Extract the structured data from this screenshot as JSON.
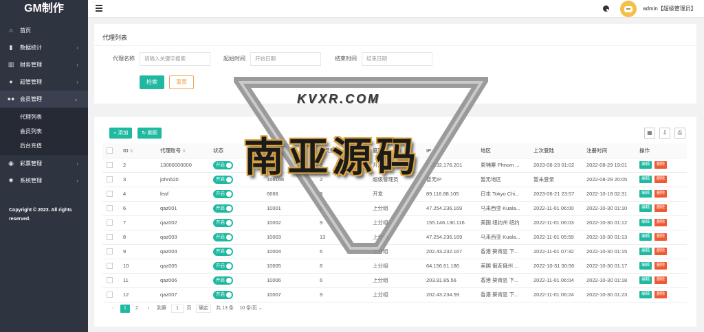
{
  "brand": "GM制作",
  "sidebar": {
    "items": [
      {
        "label": "首页"
      },
      {
        "label": "数据统计"
      },
      {
        "label": "财务管理"
      },
      {
        "label": "超管管理"
      },
      {
        "label": "会员管理"
      },
      {
        "label": "彩票管理"
      },
      {
        "label": "系统管理"
      }
    ],
    "submenu": [
      {
        "label": "代理列表"
      },
      {
        "label": "会员列表"
      },
      {
        "label": "后台充值"
      }
    ],
    "copyright_line1": "Copyright © 2023. All rights",
    "copyright_line2": "reserved."
  },
  "header": {
    "user": "admin【超级管理员】"
  },
  "search_panel": {
    "title": "代理列表",
    "fields": [
      {
        "label": "代理名称",
        "placeholder": "请输入关键字搜索"
      },
      {
        "label": "起始时间",
        "placeholder": "开始日期"
      },
      {
        "label": "结束时间",
        "placeholder": "结束日期"
      }
    ],
    "search_label": "检索",
    "reset_label": "重置"
  },
  "list_panel": {
    "add_label": "添加",
    "refresh_label": "刷新",
    "columns": [
      "ID",
      "代理账号",
      "状态",
      "邀请码",
      "成员数",
      "管理组",
      "IP",
      "地区",
      "上次登陆",
      "注册时间",
      "操作"
    ],
    "status_label": "开启",
    "edit_label": "编辑",
    "delete_label": "删除",
    "rows": [
      {
        "id": "2",
        "account": "13000000000",
        "code": "52055",
        "members": "5",
        "group": "开启",
        "ip": "152.32.176.201",
        "region": "柬埔寨 Phnom ...",
        "last_login": "2023-06-23 01:02",
        "reg_time": "2022-08-29 19:01"
      },
      {
        "id": "3",
        "account": "john520",
        "code": "166168",
        "members": "2",
        "group": "超级管理员",
        "ip": "暂无IP",
        "region": "暂无地区",
        "last_login": "暂未登录",
        "reg_time": "2022-08-29 20:05"
      },
      {
        "id": "4",
        "account": "leaf",
        "code": "6666",
        "members": "3",
        "group": "开发",
        "ip": "89.116.88.105",
        "region": "日本 Tokyo Chi...",
        "last_login": "2023-06-21 23:57",
        "reg_time": "2022-10-18 02:31"
      },
      {
        "id": "6",
        "account": "qaz001",
        "code": "10001",
        "members": "14",
        "group": "上分组",
        "ip": "47.254.236.169",
        "region": "马来西亚 Kuala...",
        "last_login": "2022-11-01 06:00",
        "reg_time": "2022-10-30 01:10"
      },
      {
        "id": "7",
        "account": "qaz002",
        "code": "10002",
        "members": "9",
        "group": "上分组",
        "ip": "155.146.130.116",
        "region": "美国 纽约州 纽约",
        "last_login": "2022-11-01 06:03",
        "reg_time": "2022-10-30 01:12"
      },
      {
        "id": "8",
        "account": "qaz003",
        "code": "10003",
        "members": "13",
        "group": "上分组",
        "ip": "47.254.236.169",
        "region": "马来西亚 Kuala...",
        "last_login": "2022-11-01 05:59",
        "reg_time": "2022-10-30 01:13"
      },
      {
        "id": "9",
        "account": "qaz004",
        "code": "10004",
        "members": "6",
        "group": "上分组",
        "ip": "202.43.232.167",
        "region": "香港 葵青區 下...",
        "last_login": "2022-11-01 07:32",
        "reg_time": "2022-10-30 01:15"
      },
      {
        "id": "10",
        "account": "qaz005",
        "code": "10005",
        "members": "8",
        "group": "上分组",
        "ip": "64.156.61.186",
        "region": "美国 俄亥俄州 ...",
        "last_login": "2022-10-31 00:56",
        "reg_time": "2022-10-30 01:17"
      },
      {
        "id": "11",
        "account": "qaz006",
        "code": "10006",
        "members": "6",
        "group": "上分组",
        "ip": "203.91.85.56",
        "region": "香港 葵青區 下...",
        "last_login": "2022-11-01 06:04",
        "reg_time": "2022-10-30 01:18"
      },
      {
        "id": "12",
        "account": "qaz007",
        "code": "10007",
        "members": "9",
        "group": "上分组",
        "ip": "202.43.234.59",
        "region": "香港 葵青區 下...",
        "last_login": "2022-11-01 06:24",
        "reg_time": "2022-10-30 01:23"
      }
    ]
  },
  "pagination": {
    "page1": "1",
    "page2": "2",
    "goto_label": "到第",
    "goto_value": "1",
    "page_unit": "页",
    "confirm_label": "确定",
    "total_label": "共 13 条",
    "per_page": "10 条/页"
  },
  "watermark": {
    "top": "KVXR.COM",
    "main": "南亚源码"
  },
  "colors": {
    "sidebar_bg": "#2f3441",
    "primary": "#1fb8a0",
    "danger": "#ee5a33",
    "reset": "#f1a254",
    "avatar": "#f5c048"
  }
}
